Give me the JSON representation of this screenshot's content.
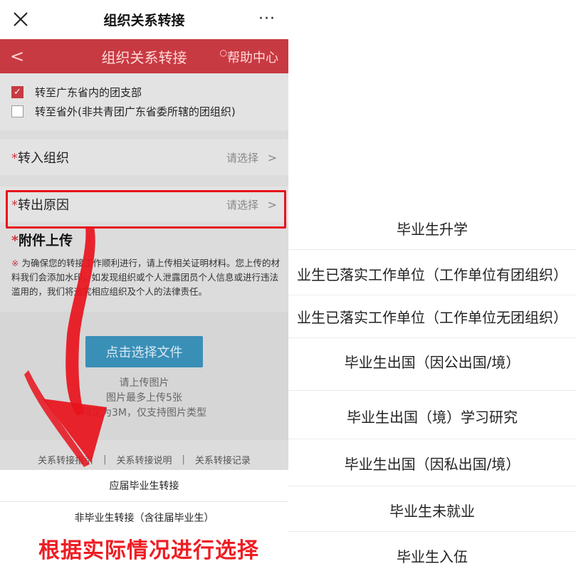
{
  "wechat_bar": {
    "title": "组织关系转接",
    "more": "···"
  },
  "nav": {
    "back": "<",
    "title": "组织关系转接",
    "help_dot": "○",
    "help": "帮助中心"
  },
  "options": [
    {
      "label": "转至广东省内的团支部",
      "checked": true
    },
    {
      "label": "转至省外(非共青团广东省委所辖的团组织)",
      "checked": false
    }
  ],
  "fields": {
    "transfer_in": {
      "star": "*",
      "label": "转入组织",
      "placeholder": "请选择"
    },
    "transfer_reason": {
      "star": "*",
      "label": "转出原因",
      "placeholder": "请选择"
    }
  },
  "upload": {
    "star": "*",
    "title": "附件上传",
    "note_mark": "※",
    "note": " 为确保您的转接工作顺利进行，请上传相关证明材料。您上传的材料我们会添加水印，如发现组织或个人泄露团员个人信息或进行违法滥用的，我们将追究相应组织及个人的法律责任。",
    "button": "点击选择文件",
    "hint1": "请上传图片",
    "hint2": "图片最多上传5张",
    "hint3": "限定为3M，仅支持图片类型"
  },
  "links": [
    "关系转接指引",
    "关系转接说明",
    "关系转接记录"
  ],
  "link_sep": "|",
  "sheet": [
    "应届毕业生转接",
    "非毕业生转接（含往届毕业生）"
  ],
  "caption": "根据实际情况进行选择",
  "reason_options": [
    "毕业生升学",
    "业生已落实工作单位（工作单位有团组织）",
    "业生已落实工作单位（工作单位无团组织）",
    "毕业生出国（因公出国/境）",
    "毕业生出国（境）学习研究",
    "毕业生出国（因私出国/境）",
    "毕业生未就业",
    "毕业生入伍"
  ],
  "colors": {
    "nav_red": "#c83a42",
    "highlight_red": "#e8121c",
    "upload_blue": "#3a8fb7",
    "caption_red": "#ee1c23"
  }
}
